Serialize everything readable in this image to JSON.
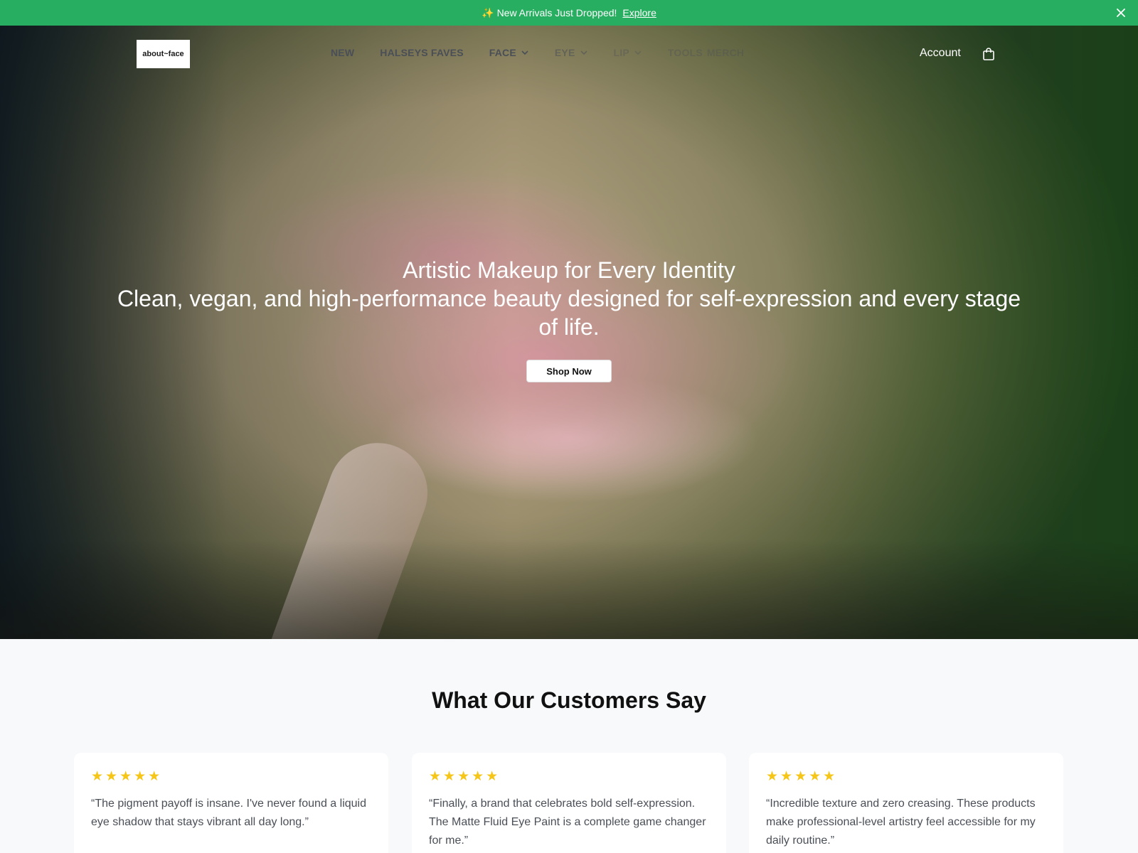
{
  "announcement": {
    "sparkle": "✨",
    "text": "New Arrivals Just Dropped!",
    "link": "Explore"
  },
  "header": {
    "logo_text": "about~face",
    "nav": [
      {
        "label": "NEW",
        "dropdown": false
      },
      {
        "label": "HALSEYS FAVES",
        "dropdown": false
      },
      {
        "label": "FACE",
        "dropdown": true
      },
      {
        "label": "EYE",
        "dropdown": true
      },
      {
        "label": "LIP",
        "dropdown": true
      },
      {
        "label": "TOOLS",
        "dropdown": false
      },
      {
        "label": "MERCH",
        "dropdown": false
      }
    ],
    "account_label": "Account",
    "cart_icon": "shopping-bag-icon"
  },
  "hero": {
    "title": "Artistic Makeup for Every Identity",
    "subtitle": "Clean, vegan, and high-performance beauty designed for self-expression and every stage of life.",
    "cta": "Shop Now"
  },
  "testimonials": {
    "heading": "What Our Customers Say",
    "items": [
      {
        "rating": 5,
        "stars": "★★★★★",
        "quote": "“The pigment payoff is insane. I've never found a liquid eye shadow that stays vibrant all day long.”"
      },
      {
        "rating": 5,
        "stars": "★★★★★",
        "quote": "“Finally, a brand that celebrates bold self-expression. The Matte Fluid Eye Paint is a complete game changer for me.”"
      },
      {
        "rating": 5,
        "stars": "★★★★★",
        "quote": "“Incredible texture and zero creasing. These products make professional-level artistry feel accessible for my daily routine.”"
      }
    ]
  },
  "colors": {
    "accent": "#27ae60",
    "star": "#f5c518",
    "nav_text": "#4a4f57"
  }
}
